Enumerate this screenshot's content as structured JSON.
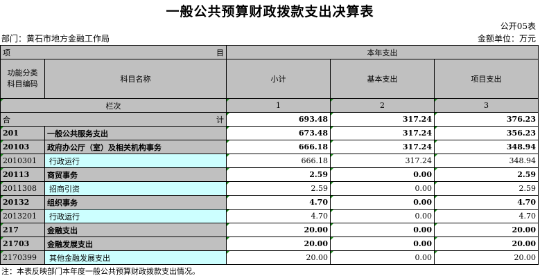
{
  "title": "一般公共预算财政拨款支出决算表",
  "form_code": "公开05表",
  "department": "部门：黄石市地方金融工作局",
  "unit": "金额单位：万元",
  "header": {
    "xiang": "项",
    "mu": "目",
    "current_year_expense": "本年支出",
    "func_code": "功能分类\n科目编码",
    "subject_name": "科目名称",
    "subtotal": "小计",
    "basic_expense": "基本支出",
    "project_expense": "项目支出",
    "column_label": "栏次",
    "col1": "1",
    "col2": "2",
    "col3": "3",
    "total_he": "合",
    "total_ji": "计"
  },
  "total": {
    "subtotal": "693.48",
    "basic": "317.24",
    "project": "376.23"
  },
  "rows": [
    {
      "code": "201",
      "name": "一般公共服务支出",
      "subtotal": "673.48",
      "basic": "317.24",
      "project": "356.23",
      "level": "bold"
    },
    {
      "code": "20103",
      "name": "政府办公厅（室）及相关机构事务",
      "subtotal": "666.18",
      "basic": "317.24",
      "project": "348.94",
      "level": "bold"
    },
    {
      "code": "2010301",
      "name": "行政运行",
      "subtotal": "666.18",
      "basic": "317.24",
      "project": "348.94",
      "level": "leaf"
    },
    {
      "code": "20113",
      "name": "商贸事务",
      "subtotal": "2.59",
      "basic": "0.00",
      "project": "2.59",
      "level": "bold"
    },
    {
      "code": "2011308",
      "name": "招商引资",
      "subtotal": "2.59",
      "basic": "0.00",
      "project": "2.59",
      "level": "leaf"
    },
    {
      "code": "20132",
      "name": "组织事务",
      "subtotal": "4.70",
      "basic": "0.00",
      "project": "4.70",
      "level": "bold"
    },
    {
      "code": "2013201",
      "name": "行政运行",
      "subtotal": "4.70",
      "basic": "0.00",
      "project": "4.70",
      "level": "leaf"
    },
    {
      "code": "217",
      "name": "金融支出",
      "subtotal": "20.00",
      "basic": "0.00",
      "project": "20.00",
      "level": "bold"
    },
    {
      "code": "21703",
      "name": "金融发展支出",
      "subtotal": "20.00",
      "basic": "0.00",
      "project": "20.00",
      "level": "bold"
    },
    {
      "code": "2170399",
      "name": "其他金融发展支出",
      "subtotal": "20.00",
      "basic": "0.00",
      "project": "20.00",
      "level": "leaf"
    }
  ],
  "note": "注：本表反映部门本年度一般公共预算财政拨款支出情况。"
}
